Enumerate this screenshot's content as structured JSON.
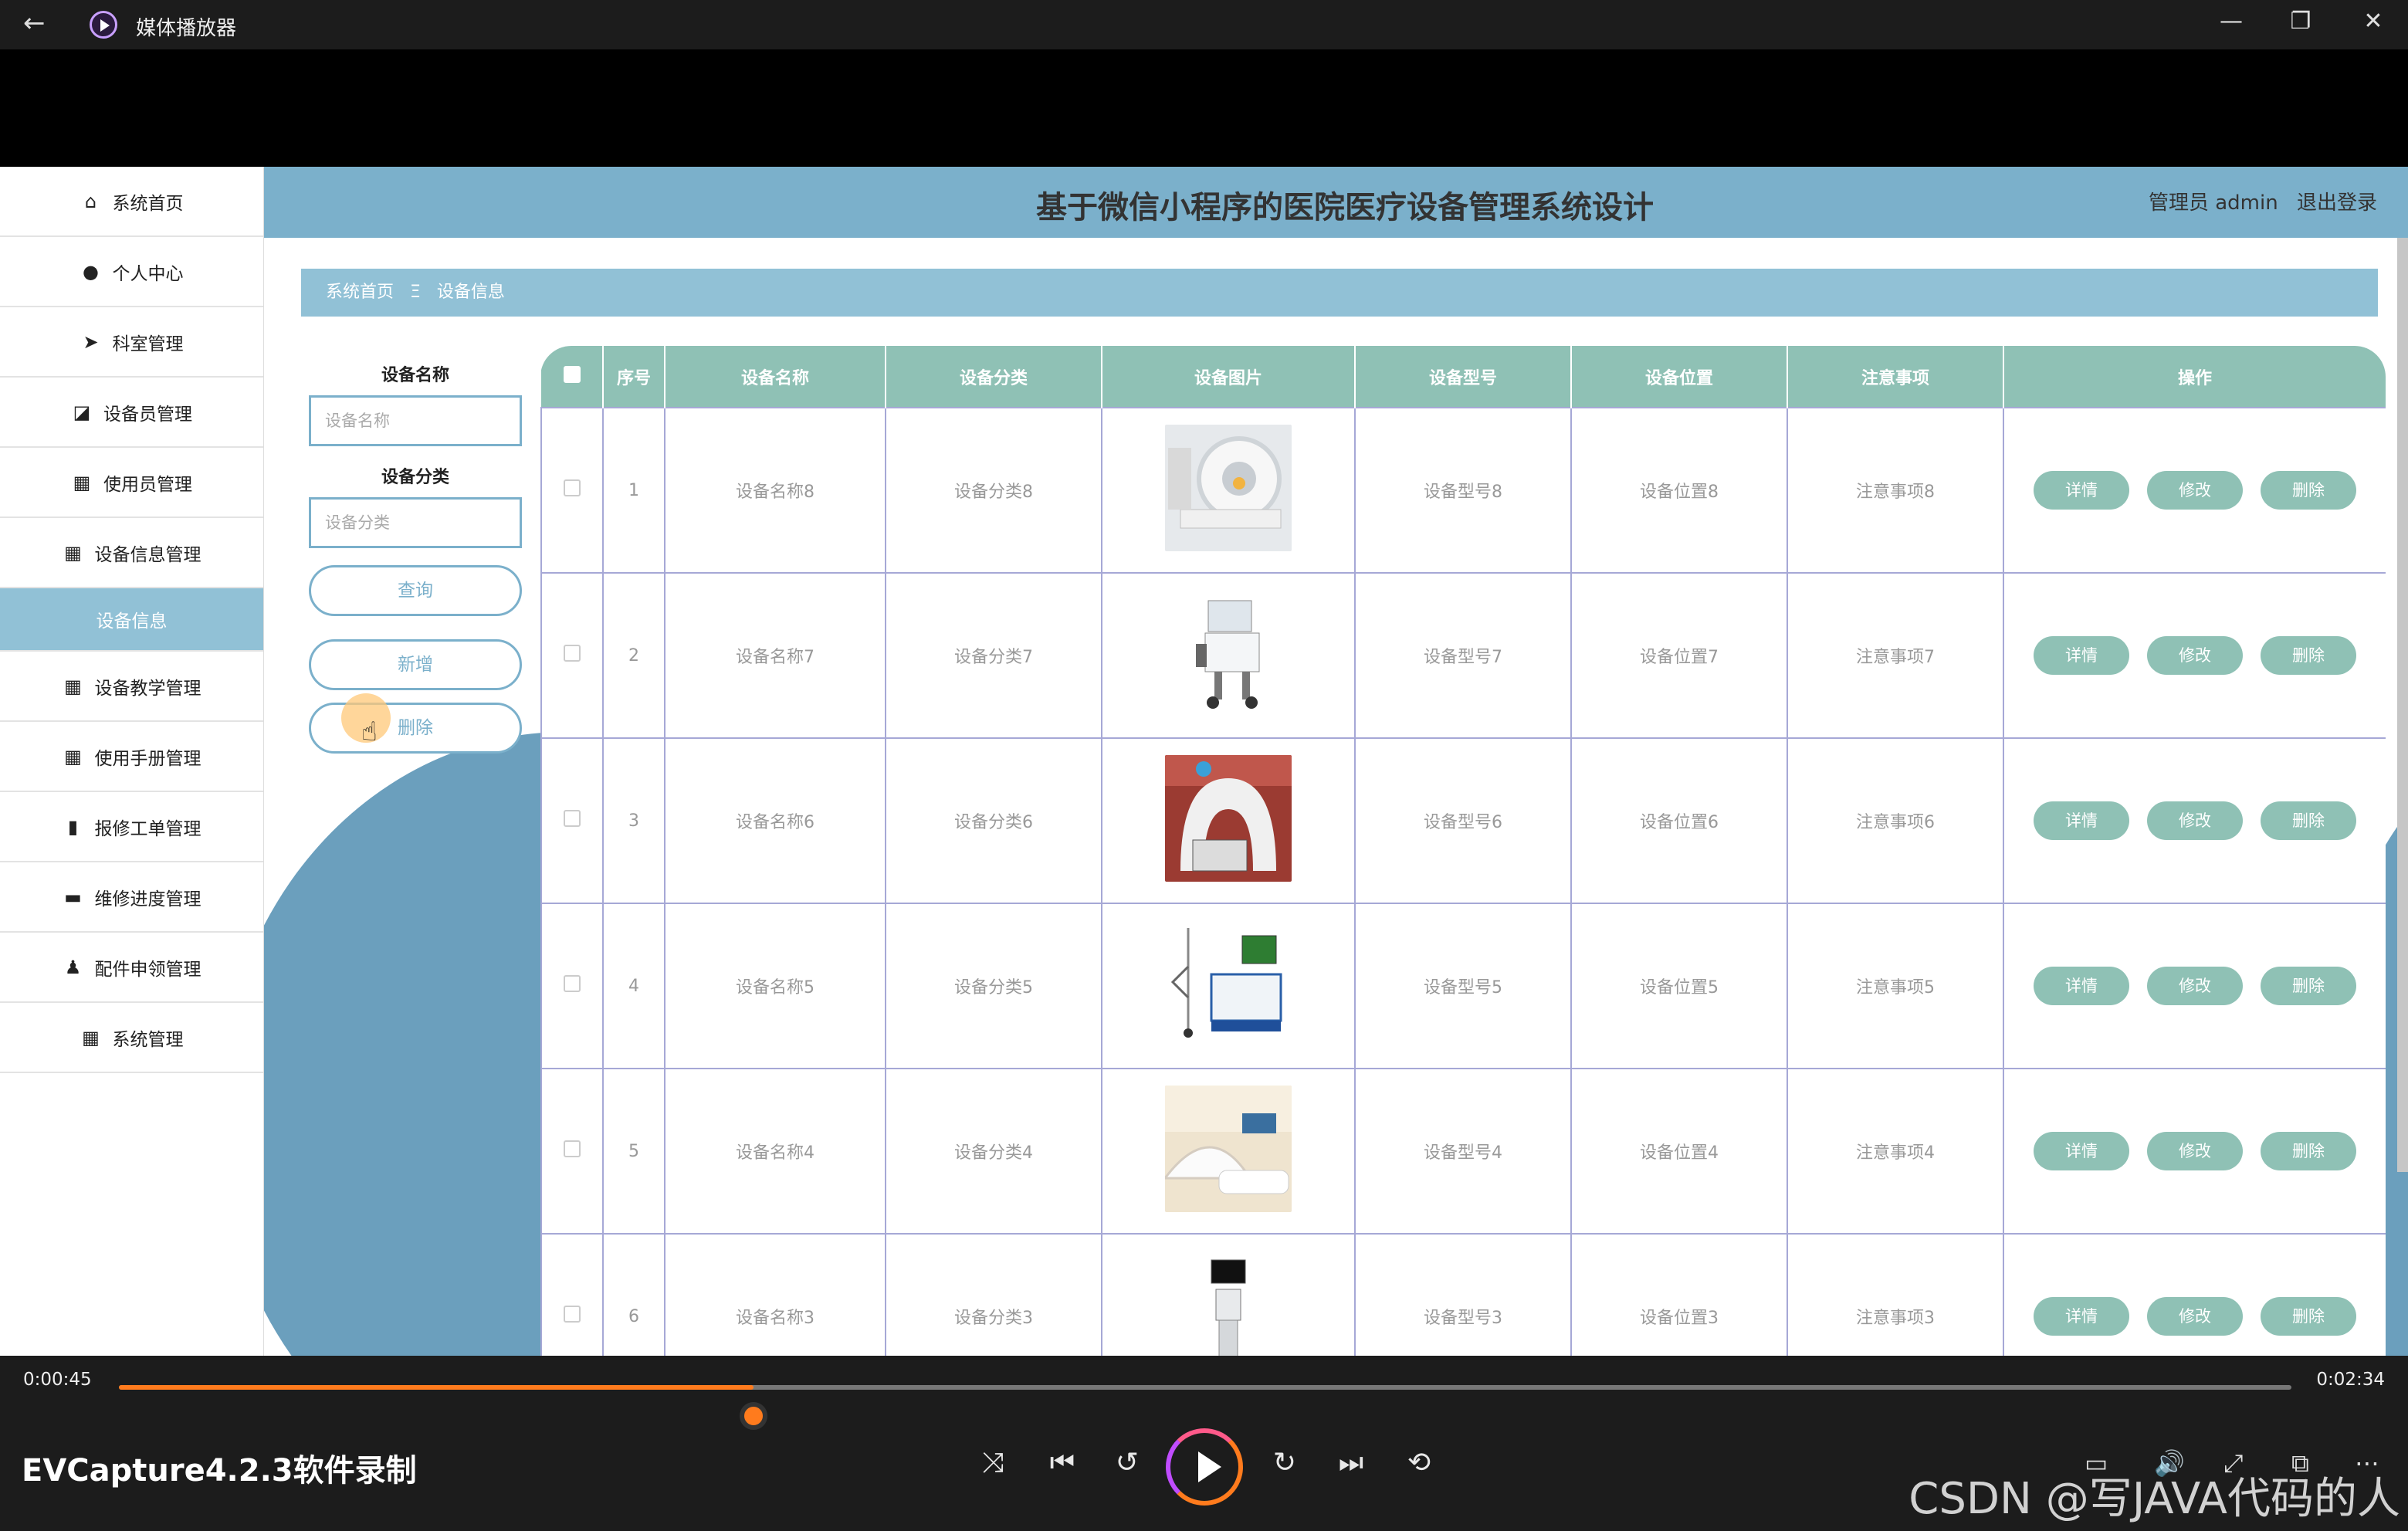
{
  "window": {
    "title": "媒体播放器",
    "back_icon": "arrow-left-icon",
    "minimize": "—",
    "restore": "❐",
    "close": "✕"
  },
  "app": {
    "header_title": "基于微信小程序的医院医疗设备管理系统设计",
    "user_role": "管理员",
    "user_name": "admin",
    "logout": "退出登录"
  },
  "sidebar": {
    "items": [
      {
        "label": "系统首页",
        "icon": "home-icon"
      },
      {
        "label": "个人中心",
        "icon": "user-icon"
      },
      {
        "label": "科室管理",
        "icon": "send-icon"
      },
      {
        "label": "设备员管理",
        "icon": "chart-box-icon"
      },
      {
        "label": "使用员管理",
        "icon": "grid-icon"
      },
      {
        "label": "设备信息管理",
        "icon": "grid-icon"
      },
      {
        "label": "设备信息",
        "icon": ""
      },
      {
        "label": "设备教学管理",
        "icon": "grid-icon"
      },
      {
        "label": "使用手册管理",
        "icon": "grid-icon"
      },
      {
        "label": "报修工单管理",
        "icon": "bar-chart-icon"
      },
      {
        "label": "维修进度管理",
        "icon": "briefcase-icon"
      },
      {
        "label": "配件申领管理",
        "icon": "person-icon"
      },
      {
        "label": "系统管理",
        "icon": "grid-icon"
      }
    ]
  },
  "breadcrumb": {
    "home": "系统首页",
    "sep": "Ξ",
    "current": "设备信息"
  },
  "search": {
    "name_label": "设备名称",
    "name_placeholder": "设备名称",
    "category_label": "设备分类",
    "category_placeholder": "设备分类",
    "query": "查询",
    "add": "新增",
    "delete": "删除"
  },
  "table": {
    "headers": [
      "序号",
      "设备名称",
      "设备分类",
      "设备图片",
      "设备型号",
      "设备位置",
      "注意事项",
      "操作"
    ],
    "op_labels": {
      "detail": "详情",
      "edit": "修改",
      "delete": "删除"
    },
    "rows": [
      {
        "no": "1",
        "name": "设备名称8",
        "category": "设备分类8",
        "model": "设备型号8",
        "location": "设备位置8",
        "notes": "注意事项8"
      },
      {
        "no": "2",
        "name": "设备名称7",
        "category": "设备分类7",
        "model": "设备型号7",
        "location": "设备位置7",
        "notes": "注意事项7"
      },
      {
        "no": "3",
        "name": "设备名称6",
        "category": "设备分类6",
        "model": "设备型号6",
        "location": "设备位置6",
        "notes": "注意事项6"
      },
      {
        "no": "4",
        "name": "设备名称5",
        "category": "设备分类5",
        "model": "设备型号5",
        "location": "设备位置5",
        "notes": "注意事项5"
      },
      {
        "no": "5",
        "name": "设备名称4",
        "category": "设备分类4",
        "model": "设备型号4",
        "location": "设备位置4",
        "notes": "注意事项4"
      },
      {
        "no": "6",
        "name": "设备名称3",
        "category": "设备分类3",
        "model": "设备型号3",
        "location": "设备位置3",
        "notes": "注意事项3"
      }
    ]
  },
  "player": {
    "current_time": "0:00:45",
    "total_time": "0:02:34",
    "progress": 0.292,
    "caption": "EVCapture4.2.3软件录制",
    "watermark": "CSDN @写JAVA代码的人",
    "accent": "#ff7b1d"
  },
  "colors": {
    "header": "#7bb0cb",
    "breadcrumb": "#91c1d6",
    "table_header": "#8fc1b5",
    "op_button": "#8fc1b5"
  }
}
